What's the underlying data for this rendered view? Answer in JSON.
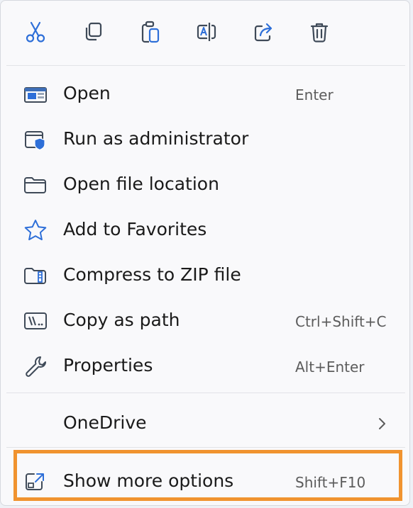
{
  "colors": {
    "accent": "#2e6fd8",
    "icon_stroke": "#3f4a58",
    "highlight": "#f0932f",
    "text": "#1a1a1a",
    "shortcut_text": "#5c5c5c"
  },
  "toolbar": {
    "items": [
      {
        "icon": "cut-icon"
      },
      {
        "icon": "copy-icon"
      },
      {
        "icon": "paste-icon"
      },
      {
        "icon": "rename-icon"
      },
      {
        "icon": "share-icon"
      },
      {
        "icon": "delete-icon"
      }
    ]
  },
  "menu": {
    "items": [
      {
        "label": "Open",
        "shortcut": "Enter",
        "icon": "app-window-icon"
      },
      {
        "label": "Run as administrator",
        "shortcut": "",
        "icon": "admin-shield-icon"
      },
      {
        "label": "Open file location",
        "shortcut": "",
        "icon": "folder-icon"
      },
      {
        "label": "Add to Favorites",
        "shortcut": "",
        "icon": "star-icon"
      },
      {
        "label": "Compress to ZIP file",
        "shortcut": "",
        "icon": "zip-folder-icon"
      },
      {
        "label": "Copy as path",
        "shortcut": "Ctrl+Shift+C",
        "icon": "path-icon"
      },
      {
        "label": "Properties",
        "shortcut": "Alt+Enter",
        "icon": "wrench-icon"
      }
    ],
    "onedrive": {
      "label": "OneDrive",
      "icon": "chevron-right-icon"
    },
    "more_options": {
      "label": "Show more options",
      "shortcut": "Shift+F10",
      "icon": "expand-icon"
    }
  }
}
